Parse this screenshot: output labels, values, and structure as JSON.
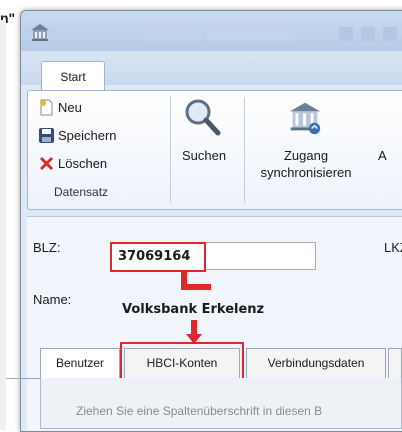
{
  "stray_text": "n\"",
  "ribbon": {
    "tab_label": "Start",
    "items": {
      "new": "Neu",
      "save": "Speichern",
      "delete": "Löschen"
    },
    "group_label": "Datensatz",
    "search_label": "Suchen",
    "sync_label_line1": "Zugang",
    "sync_label_line2": "synchronisieren",
    "cut_label": "A"
  },
  "form": {
    "blz_label": "BLZ:",
    "blz_value": "37069164",
    "lk_label": "LKZ",
    "name_label": "Name:",
    "name_value": "Volksbank Erkelenz"
  },
  "tabs": [
    "Benutzer",
    "HBCI-Konten",
    "Verbindungsdaten"
  ],
  "hint_text": "Ziehen Sie eine Spaltenüberschrift in diesen B",
  "colors": {
    "highlight": "#e0272a",
    "accent": "#3b6fb6"
  },
  "icons": [
    "app-icon",
    "new-icon",
    "save-icon",
    "delete-icon",
    "search-icon",
    "bank-sync-icon"
  ]
}
